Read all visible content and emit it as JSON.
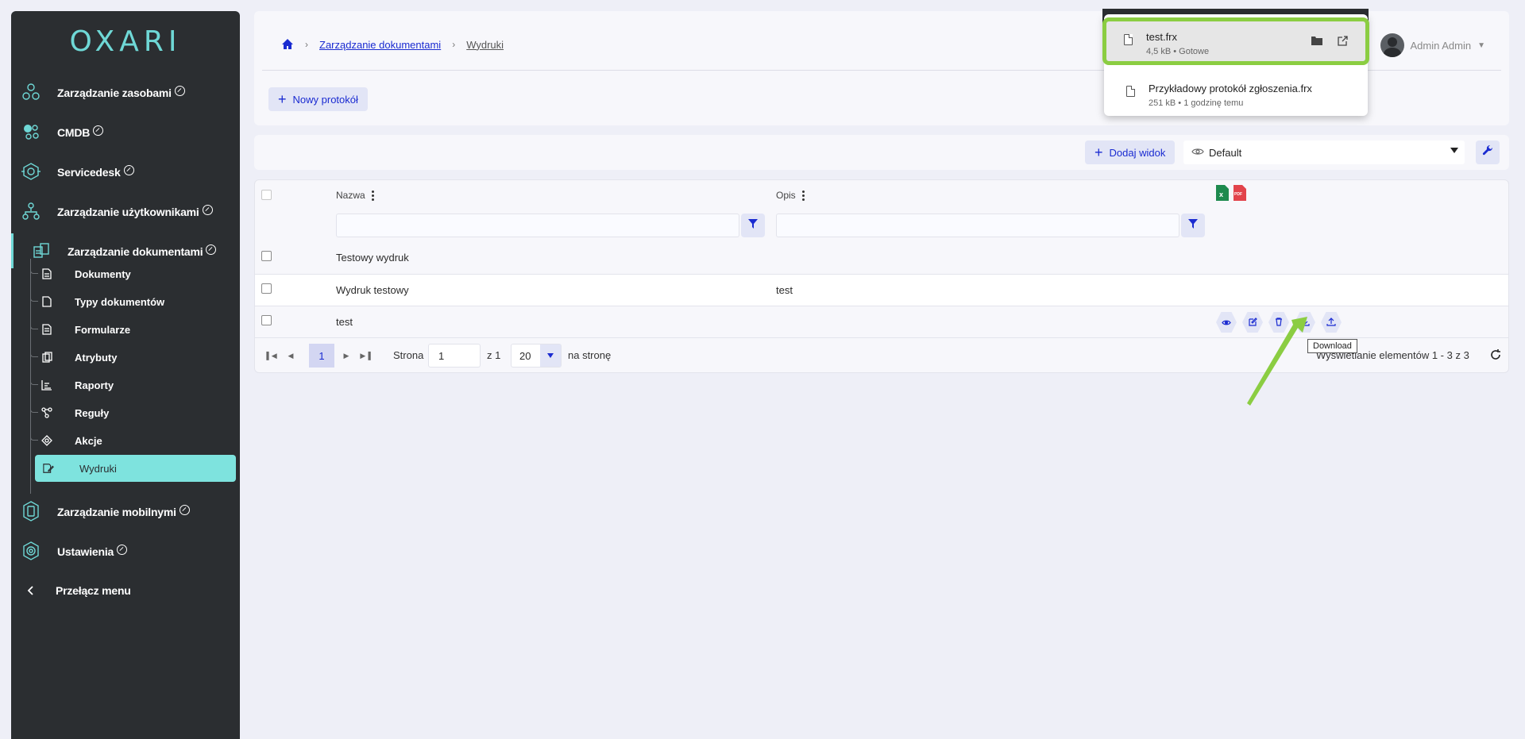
{
  "brand": {
    "logo": "OXARI",
    "accent": "#6fd8d6",
    "link_color": "#1a2bd1",
    "highlight_color": "#8bcd42"
  },
  "sidebar": {
    "items": [
      {
        "label": "Zarządzanie zasobami",
        "icon": "hexagons-icon"
      },
      {
        "label": "CMDB",
        "icon": "cmdb-icon"
      },
      {
        "label": "Servicedesk",
        "icon": "servicedesk-icon"
      },
      {
        "label": "Zarządzanie użytkownikami",
        "icon": "users-tree-icon"
      },
      {
        "label": "Zarządzanie dokumentami",
        "icon": "documents-icon"
      },
      {
        "label": "Zarządzanie mobilnymi",
        "icon": "mobile-icon"
      },
      {
        "label": "Ustawienia",
        "icon": "settings-icon"
      }
    ],
    "sub_items": [
      {
        "label": "Dokumenty",
        "icon": "document-icon"
      },
      {
        "label": "Typy dokumentów",
        "icon": "file-icon"
      },
      {
        "label": "Formularze",
        "icon": "form-icon"
      },
      {
        "label": "Atrybuty",
        "icon": "attributes-icon"
      },
      {
        "label": "Raporty",
        "icon": "chart-icon"
      },
      {
        "label": "Reguły",
        "icon": "rules-icon"
      },
      {
        "label": "Akcje",
        "icon": "actions-icon"
      },
      {
        "label": "Wydruki",
        "icon": "print-icon"
      }
    ],
    "toggle_label": "Przełącz menu"
  },
  "header": {
    "breadcrumb": [
      "Zarządzanie dokumentami",
      "Wydruki"
    ],
    "new_button": "Nowy protokół",
    "user_name": "Admin Admin"
  },
  "viewbar": {
    "add_view": "Dodaj widok",
    "view_selected": "Default"
  },
  "table": {
    "columns": [
      "Nazwa",
      "Opis"
    ],
    "rows": [
      {
        "name": "Testowy wydruk",
        "desc": ""
      },
      {
        "name": "Wydruk testowy",
        "desc": "test"
      },
      {
        "name": "test",
        "desc": ""
      }
    ],
    "export_icons": [
      "excel-icon",
      "pdf-icon"
    ]
  },
  "pager": {
    "current_page": "1",
    "page_label": "Strona",
    "page_input": "1",
    "of_label": "z 1",
    "page_size": "20",
    "per_page_label": "na stronę",
    "summary": "Wyświetlanie elementów 1 - 3 z 3"
  },
  "tooltip": "Download",
  "downloads": [
    {
      "name": "test.frx",
      "meta": "4,5 kB • Gotowe"
    },
    {
      "name": "Przykładowy protokół zgłoszenia.frx",
      "meta": "251 kB • 1 godzinę temu"
    }
  ]
}
